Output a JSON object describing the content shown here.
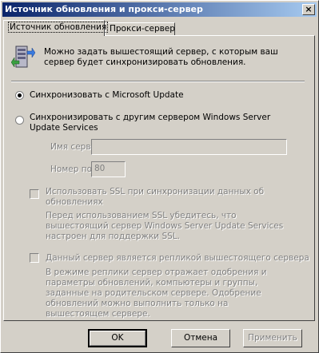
{
  "window": {
    "title": "Источник обновления и прокси-сервер",
    "close_glyph": "×"
  },
  "tabs": [
    {
      "label": "Источник обновления",
      "active": true
    },
    {
      "label": "Прокси-сервер",
      "active": false
    }
  ],
  "intro": {
    "icon": "server-sync-icon",
    "text": "Можно задать вышестоящий сервер, с которым ваш сервер будет синхронизировать обновления."
  },
  "options": {
    "microsoft_update": {
      "label": "Синхронизовать с Microsoft Update",
      "selected": true
    },
    "other_server": {
      "label": "Синхронизировать с другим сервером Windows Server Update Services",
      "selected": false
    }
  },
  "server_name": {
    "label": "Имя сервера:",
    "value": ""
  },
  "port": {
    "label": "Номер порта:",
    "value": "80"
  },
  "ssl": {
    "label": "Использовать SSL при синхронизации данных об обновлениях",
    "note": "Перед использованием SSL убедитесь, что вышестоящий сервер Windows Server Update Services настроен для поддержки SSL.",
    "checked": false
  },
  "replica": {
    "label": "Данный сервер является репликой вышестоящего сервера",
    "note": "В режиме реплики сервер отражает одобрения и параметры обновлений, компьютеры и группы, заданные на родительском сервере. Одобрение обновлений можно выполнить только на вышестоящем сервере.",
    "checked": false
  },
  "buttons": {
    "ok": "OK",
    "cancel": "Отмена",
    "apply": "Применить"
  }
}
